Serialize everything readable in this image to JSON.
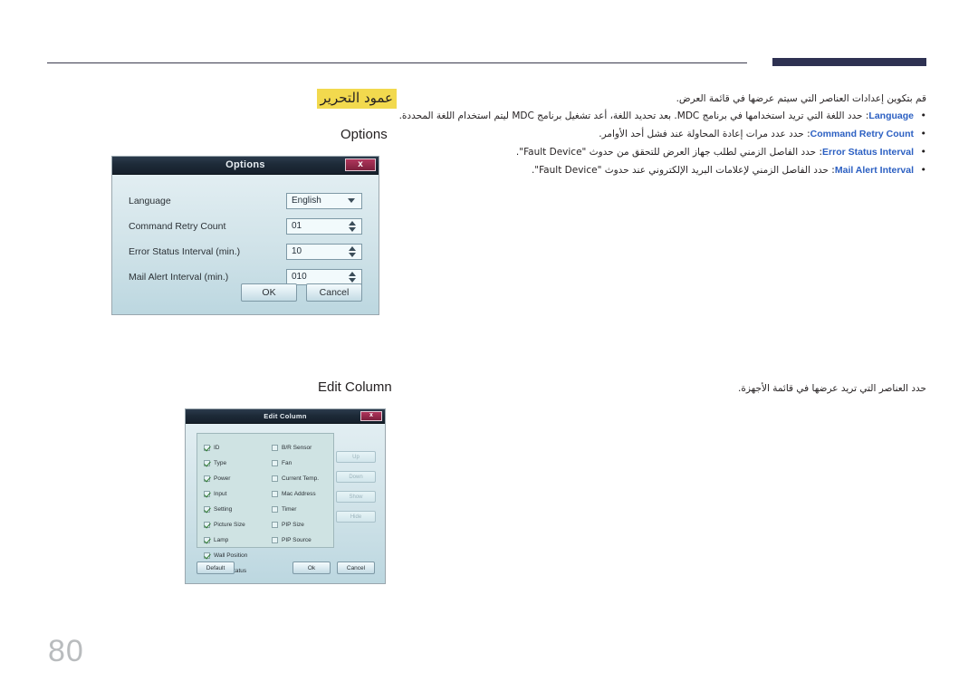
{
  "page": {
    "number": "80",
    "heading_ar": "عمود التحرير"
  },
  "colors": {
    "highlight": "#f2d94e",
    "header_bar": "#2e3152",
    "term_blue": "#2b5fc2",
    "page_number": "#b9bcbe"
  },
  "options_section": {
    "label": "Options",
    "intro_ar": "قم بتكوين إعدادات العناصر التي سيتم عرضها في قائمة العرض.",
    "bullets": [
      {
        "term": "Language",
        "text_ar": ": حدد اللغة التي تريد استخدامها في برنامج MDC. بعد تحديد اللغة، أعد تشغيل برنامج MDC ليتم استخدام اللغة المحددة."
      },
      {
        "term": "Command Retry Count",
        "text_ar": ": حدد عدد مرات إعادة المحاولة عند فشل أحد الأوامر."
      },
      {
        "term": "Error Status Interval",
        "text_ar": ": حدد الفاصل الزمني لطلب جهاز العرض للتحقق من حدوث \"Fault Device\"."
      },
      {
        "term": "Mail Alert Interval",
        "text_ar": ": حدد الفاصل الزمني لإعلامات البريد الإلكتروني عند حدوث \"Fault Device\"."
      }
    ]
  },
  "options_dialog": {
    "title": "Options",
    "close_label": "x",
    "rows": [
      {
        "label": "Language",
        "value": "English",
        "control": "dropdown"
      },
      {
        "label": "Command Retry Count",
        "value": "01",
        "control": "spinner"
      },
      {
        "label": "Error Status Interval (min.)",
        "value": "10",
        "control": "spinner"
      },
      {
        "label": "Mail Alert Interval (min.)",
        "value": "010",
        "control": "spinner"
      }
    ],
    "ok_label": "OK",
    "cancel_label": "Cancel"
  },
  "edit_column_section": {
    "label": "Edit Column",
    "desc_ar": "حدد العناصر التي تريد عرضها في قائمة الأجهزة."
  },
  "edit_column_dialog": {
    "title": "Edit Column",
    "close_label": "x",
    "left_column": [
      {
        "label": "ID",
        "checked": true
      },
      {
        "label": "Type",
        "checked": true
      },
      {
        "label": "Power",
        "checked": true
      },
      {
        "label": "Input",
        "checked": true
      },
      {
        "label": "Setting",
        "checked": true
      },
      {
        "label": "Picture Size",
        "checked": true
      },
      {
        "label": "Lamp",
        "checked": true
      },
      {
        "label": "Wall Position",
        "checked": true
      },
      {
        "label": "Temp Status",
        "checked": false
      }
    ],
    "right_column": [
      {
        "label": "B/R Sensor",
        "checked": false
      },
      {
        "label": "Fan",
        "checked": false
      },
      {
        "label": "Current Temp.",
        "checked": false
      },
      {
        "label": "Mac Address",
        "checked": false
      },
      {
        "label": "Timer",
        "checked": false
      },
      {
        "label": "PIP Size",
        "checked": false
      },
      {
        "label": "PIP Source",
        "checked": false
      }
    ],
    "side_buttons": [
      "Up",
      "Down",
      "Show",
      "Hide"
    ],
    "default_label": "Default",
    "ok_label": "Ok",
    "cancel_label": "Cancel"
  }
}
